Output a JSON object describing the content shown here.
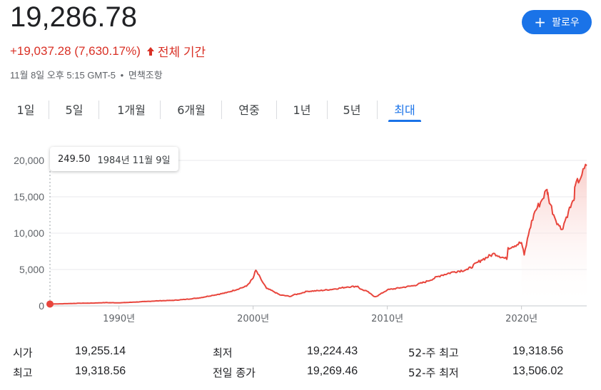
{
  "quote": {
    "price": "19,286.78",
    "change": "+19,037.28 (7,630.17%)",
    "period": "전체 기간",
    "timestamp": "11월 8일 오후 5:15 GMT-5",
    "separator": "•",
    "disclaimer": "면책조항"
  },
  "follow_button": {
    "label": "팔로우"
  },
  "tabs": [
    {
      "label": "1일",
      "active": false
    },
    {
      "label": "5일",
      "active": false
    },
    {
      "label": "1개월",
      "active": false
    },
    {
      "label": "6개월",
      "active": false
    },
    {
      "label": "연중",
      "active": false
    },
    {
      "label": "1년",
      "active": false
    },
    {
      "label": "5년",
      "active": false
    },
    {
      "label": "최대",
      "active": true
    }
  ],
  "tooltip": {
    "value": "249.50",
    "date": "1984년 11월 9일"
  },
  "colors": {
    "line": "#e8453c",
    "fill_top": "#f8c8c4",
    "accent": "#1a73e8",
    "negative_text": "#d93025",
    "grid": "#e8eaed"
  },
  "chart_data": {
    "type": "area",
    "x_unit": "year",
    "ylim": [
      0,
      20000
    ],
    "xlim": [
      1984.86,
      2024.86
    ],
    "y_ticks": [
      "0",
      "5,000",
      "10,000",
      "15,000",
      "20,000"
    ],
    "x_ticks": [
      "1990년",
      "2000년",
      "2010년",
      "2020년"
    ],
    "grid": true,
    "highlight_point": {
      "x": 1984.86,
      "y": 249.5
    },
    "series": [
      {
        "x": [
          1984.86,
          1986,
          1987,
          1988,
          1989,
          1990,
          1991,
          1992,
          1993,
          1994,
          1995,
          1996,
          1997,
          1998,
          1999,
          1999.5,
          2000,
          2000.2,
          2000.6,
          2001,
          2001.5,
          2002,
          2002.8,
          2003,
          2003.5,
          2004,
          2005,
          2006,
          2007,
          2007.8,
          2008,
          2008.5,
          2009,
          2009.2,
          2010,
          2011,
          2012,
          2013,
          2014,
          2015,
          2016,
          2017,
          2018,
          2018.9,
          2019,
          2020,
          2020.2,
          2020.6,
          2021,
          2021.5,
          2021.9,
          2022,
          2022.4,
          2022.8,
          2023,
          2023.5,
          2023.9,
          2024,
          2024.5,
          2024.86
        ],
        "values": [
          250,
          300,
          360,
          380,
          450,
          420,
          500,
          600,
          700,
          750,
          900,
          1100,
          1450,
          1800,
          2400,
          2700,
          3800,
          4900,
          3600,
          2400,
          2000,
          1500,
          1300,
          1500,
          1700,
          2000,
          2100,
          2300,
          2600,
          2700,
          2300,
          2000,
          1300,
          1300,
          2200,
          2500,
          2800,
          3400,
          4200,
          4700,
          5000,
          6300,
          7200,
          6400,
          8000,
          8700,
          7000,
          10500,
          13000,
          14500,
          16000,
          15000,
          12500,
          11000,
          10500,
          13000,
          14500,
          16500,
          18000,
          19287
        ]
      }
    ]
  }
}
